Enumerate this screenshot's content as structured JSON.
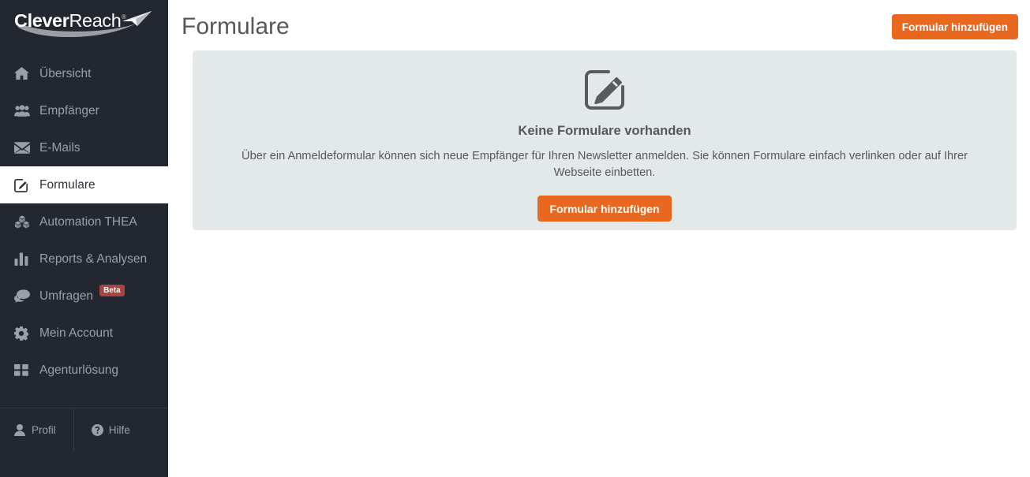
{
  "brand": {
    "name_bold": "Clever",
    "name_light": "Reach",
    "registered_mark": "®",
    "logo_icon": "paper-plane-icon"
  },
  "sidebar": {
    "items": [
      {
        "label": "Übersicht",
        "icon": "home-icon",
        "active": false
      },
      {
        "label": "Empfänger",
        "icon": "users-icon",
        "active": false
      },
      {
        "label": "E-Mails",
        "icon": "envelope-icon",
        "active": false
      },
      {
        "label": "Formulare",
        "icon": "edit-square-icon",
        "active": true
      },
      {
        "label": "Automation THEA",
        "icon": "cubes-icon",
        "active": false
      },
      {
        "label": "Reports & Analysen",
        "icon": "bar-chart-icon",
        "active": false
      },
      {
        "label": "Umfragen",
        "icon": "comments-icon",
        "active": false,
        "badge": "Beta"
      },
      {
        "label": "Mein Account",
        "icon": "gear-icon",
        "active": false
      },
      {
        "label": "Agenturlösung",
        "icon": "grid-icon",
        "active": false
      }
    ],
    "footer": {
      "profile_label": "Profil",
      "profile_icon": "user-icon",
      "help_label": "Hilfe",
      "help_icon": "question-circle-icon"
    }
  },
  "header": {
    "title": "Formulare",
    "add_form_button": "Formular hinzufügen"
  },
  "empty_state": {
    "icon": "edit-square-icon",
    "title": "Keine Formulare vorhanden",
    "description": "Über ein Anmeldeformular können sich neue Empfänger für Ihren Newsletter anmelden. Sie können Formulare einfach verlinken oder auf Ihrer Webseite einbetten.",
    "button_label": "Formular hinzufügen"
  },
  "colors": {
    "accent_orange": "#e8681f",
    "sidebar_dark": "#232830",
    "panel_gray": "#e3e8e8",
    "badge_red": "#a94442",
    "muted_text": "#9aa0a8",
    "heading_text": "#56585b"
  }
}
